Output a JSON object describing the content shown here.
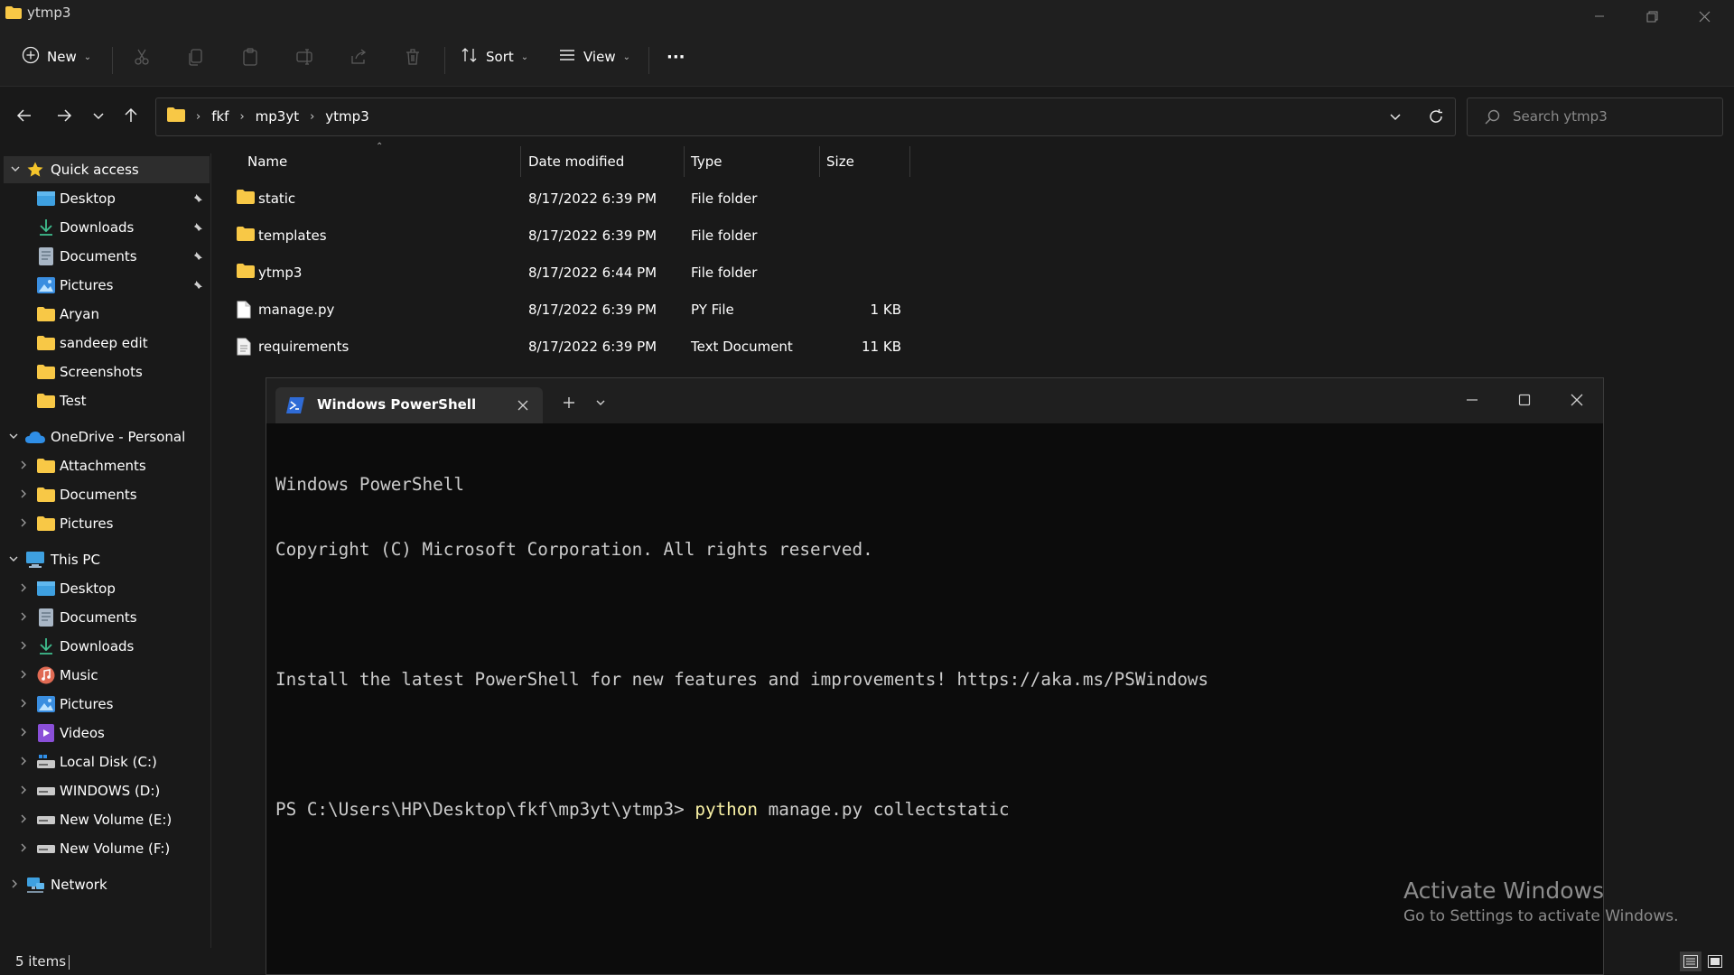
{
  "window": {
    "title": "ytmp3"
  },
  "toolbar": {
    "new_label": "New",
    "sort_label": "Sort",
    "view_label": "View",
    "more_label": "···"
  },
  "address": {
    "crumbs": [
      "fkf",
      "mp3yt",
      "ytmp3"
    ]
  },
  "search": {
    "placeholder": "Search ytmp3"
  },
  "sidebar": {
    "quick_access": "Quick access",
    "quick_items": [
      {
        "label": "Desktop",
        "icon": "desktop-icon",
        "pinned": true
      },
      {
        "label": "Downloads",
        "icon": "downloads-icon",
        "pinned": true
      },
      {
        "label": "Documents",
        "icon": "documents-icon",
        "pinned": true
      },
      {
        "label": "Pictures",
        "icon": "pictures-icon",
        "pinned": true
      },
      {
        "label": "Aryan",
        "icon": "folder-icon",
        "pinned": false
      },
      {
        "label": "sandeep edit",
        "icon": "folder-icon",
        "pinned": false
      },
      {
        "label": "Screenshots",
        "icon": "folder-icon",
        "pinned": false
      },
      {
        "label": "Test",
        "icon": "folder-icon",
        "pinned": false
      }
    ],
    "onedrive": "OneDrive - Personal",
    "onedrive_items": [
      {
        "label": "Attachments",
        "icon": "folder-icon"
      },
      {
        "label": "Documents",
        "icon": "folder-icon"
      },
      {
        "label": "Pictures",
        "icon": "folder-icon"
      }
    ],
    "this_pc": "This PC",
    "pc_items": [
      {
        "label": "Desktop",
        "icon": "desktop-icon"
      },
      {
        "label": "Documents",
        "icon": "documents-icon"
      },
      {
        "label": "Downloads",
        "icon": "downloads-icon"
      },
      {
        "label": "Music",
        "icon": "music-icon"
      },
      {
        "label": "Pictures",
        "icon": "pictures-icon"
      },
      {
        "label": "Videos",
        "icon": "videos-icon"
      },
      {
        "label": "Local Disk (C:)",
        "icon": "local-disk-icon"
      },
      {
        "label": "WINDOWS (D:)",
        "icon": "drive-icon"
      },
      {
        "label": "New Volume (E:)",
        "icon": "drive-icon"
      },
      {
        "label": "New Volume (F:)",
        "icon": "drive-icon"
      }
    ],
    "network": "Network"
  },
  "files": {
    "columns": [
      "Name",
      "Date modified",
      "Type",
      "Size"
    ],
    "rows": [
      {
        "name": "static",
        "date": "8/17/2022 6:39 PM",
        "type": "File folder",
        "size": "",
        "icon": "folder-icon"
      },
      {
        "name": "templates",
        "date": "8/17/2022 6:39 PM",
        "type": "File folder",
        "size": "",
        "icon": "folder-icon"
      },
      {
        "name": "ytmp3",
        "date": "8/17/2022 6:44 PM",
        "type": "File folder",
        "size": "",
        "icon": "folder-icon"
      },
      {
        "name": "manage.py",
        "date": "8/17/2022 6:39 PM",
        "type": "PY File",
        "size": "1 KB",
        "icon": "file-icon"
      },
      {
        "name": "requirements",
        "date": "8/17/2022 6:39 PM",
        "type": "Text Document",
        "size": "11 KB",
        "icon": "text-file-icon"
      }
    ]
  },
  "status": {
    "items": "5 items"
  },
  "watermark": {
    "line1": "Activate Windows",
    "line2": "Go to Settings to activate Windows."
  },
  "terminal": {
    "tab_title": "Windows PowerShell",
    "lines": [
      "Windows PowerShell",
      "Copyright (C) Microsoft Corporation. All rights reserved.",
      "",
      "Install the latest PowerShell for new features and improvements! https://aka.ms/PSWindows",
      ""
    ],
    "prompt": "PS C:\\Users\\HP\\Desktop\\fkf\\mp3yt\\ytmp3> ",
    "command_keyword": "python",
    "command_rest": " manage.py collectstatic"
  },
  "colors": {
    "folder": "#f8c846",
    "accent_blue": "#4cc2ff",
    "terminal_bg": "#0c0c0c",
    "keyword": "#f9f1a5"
  }
}
